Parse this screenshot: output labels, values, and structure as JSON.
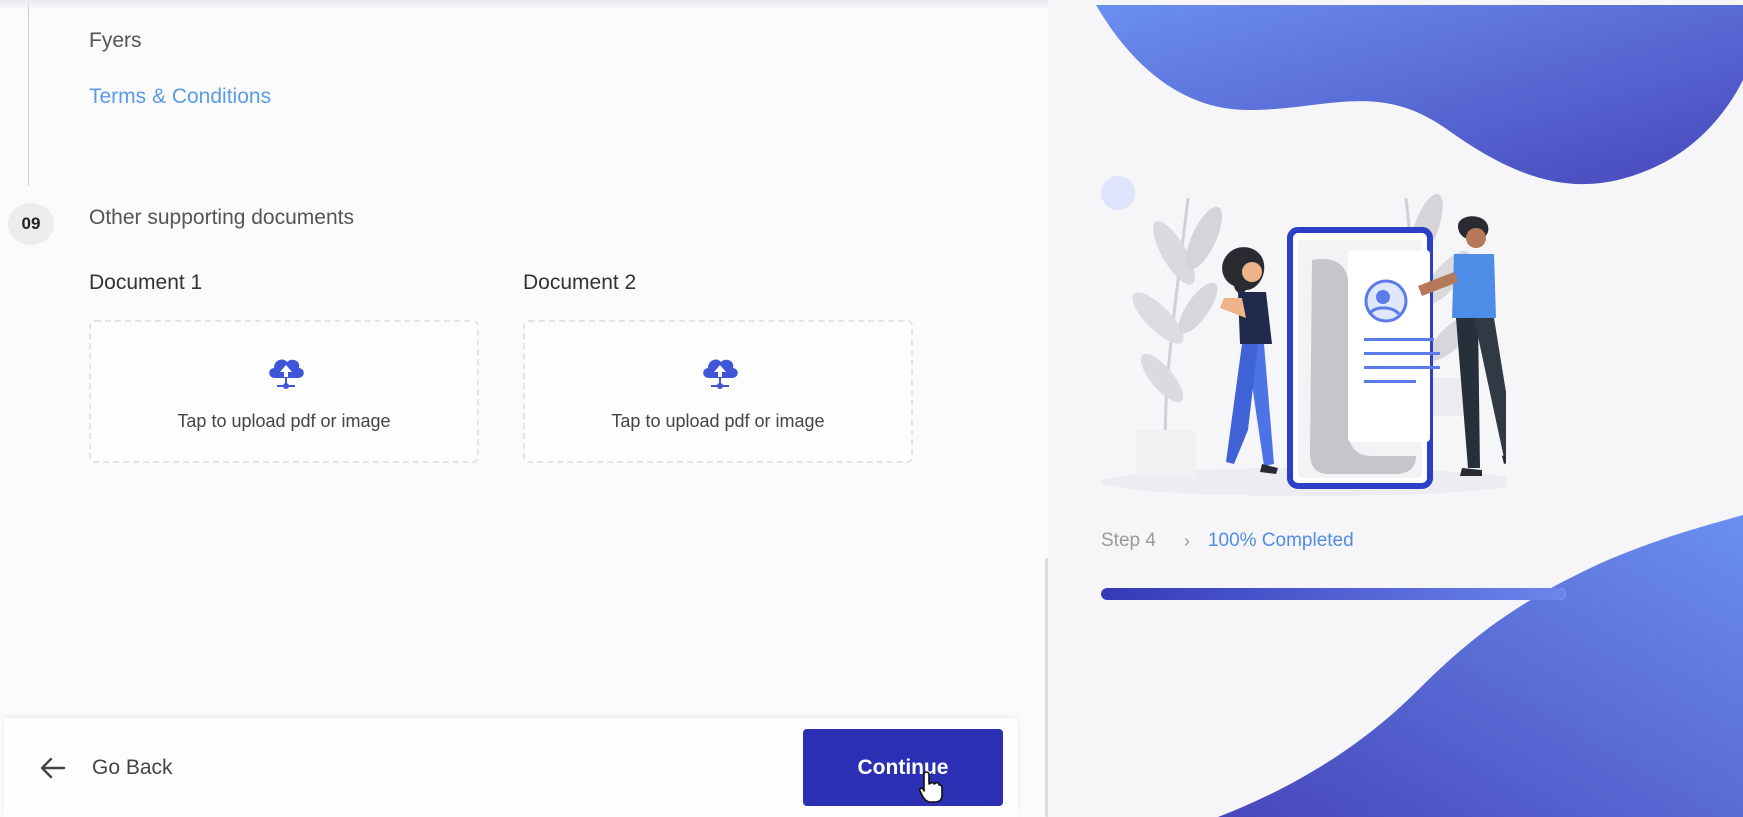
{
  "documents": {
    "broker_name": "Fyers",
    "terms_link": "Terms & Conditions",
    "step_number": "09",
    "section_title": "Other supporting documents",
    "items": [
      {
        "label": "Document 1",
        "upload_text": "Tap to upload pdf or image",
        "icon": "cloud-upload-icon"
      },
      {
        "label": "Document 2",
        "upload_text": "Tap to upload pdf or image",
        "icon": "cloud-upload-icon"
      }
    ]
  },
  "footer": {
    "back_label": "Go Back",
    "continue_label": "Continue"
  },
  "progress": {
    "step_label": "Step 4",
    "chevron": "›",
    "completed_label": "100% Completed",
    "fraction": 1.0
  },
  "colors": {
    "accent": "#2b2fb4",
    "link": "#5b9be6",
    "blob_start": "#6b86ec",
    "blob_end": "#3f3fb8"
  }
}
